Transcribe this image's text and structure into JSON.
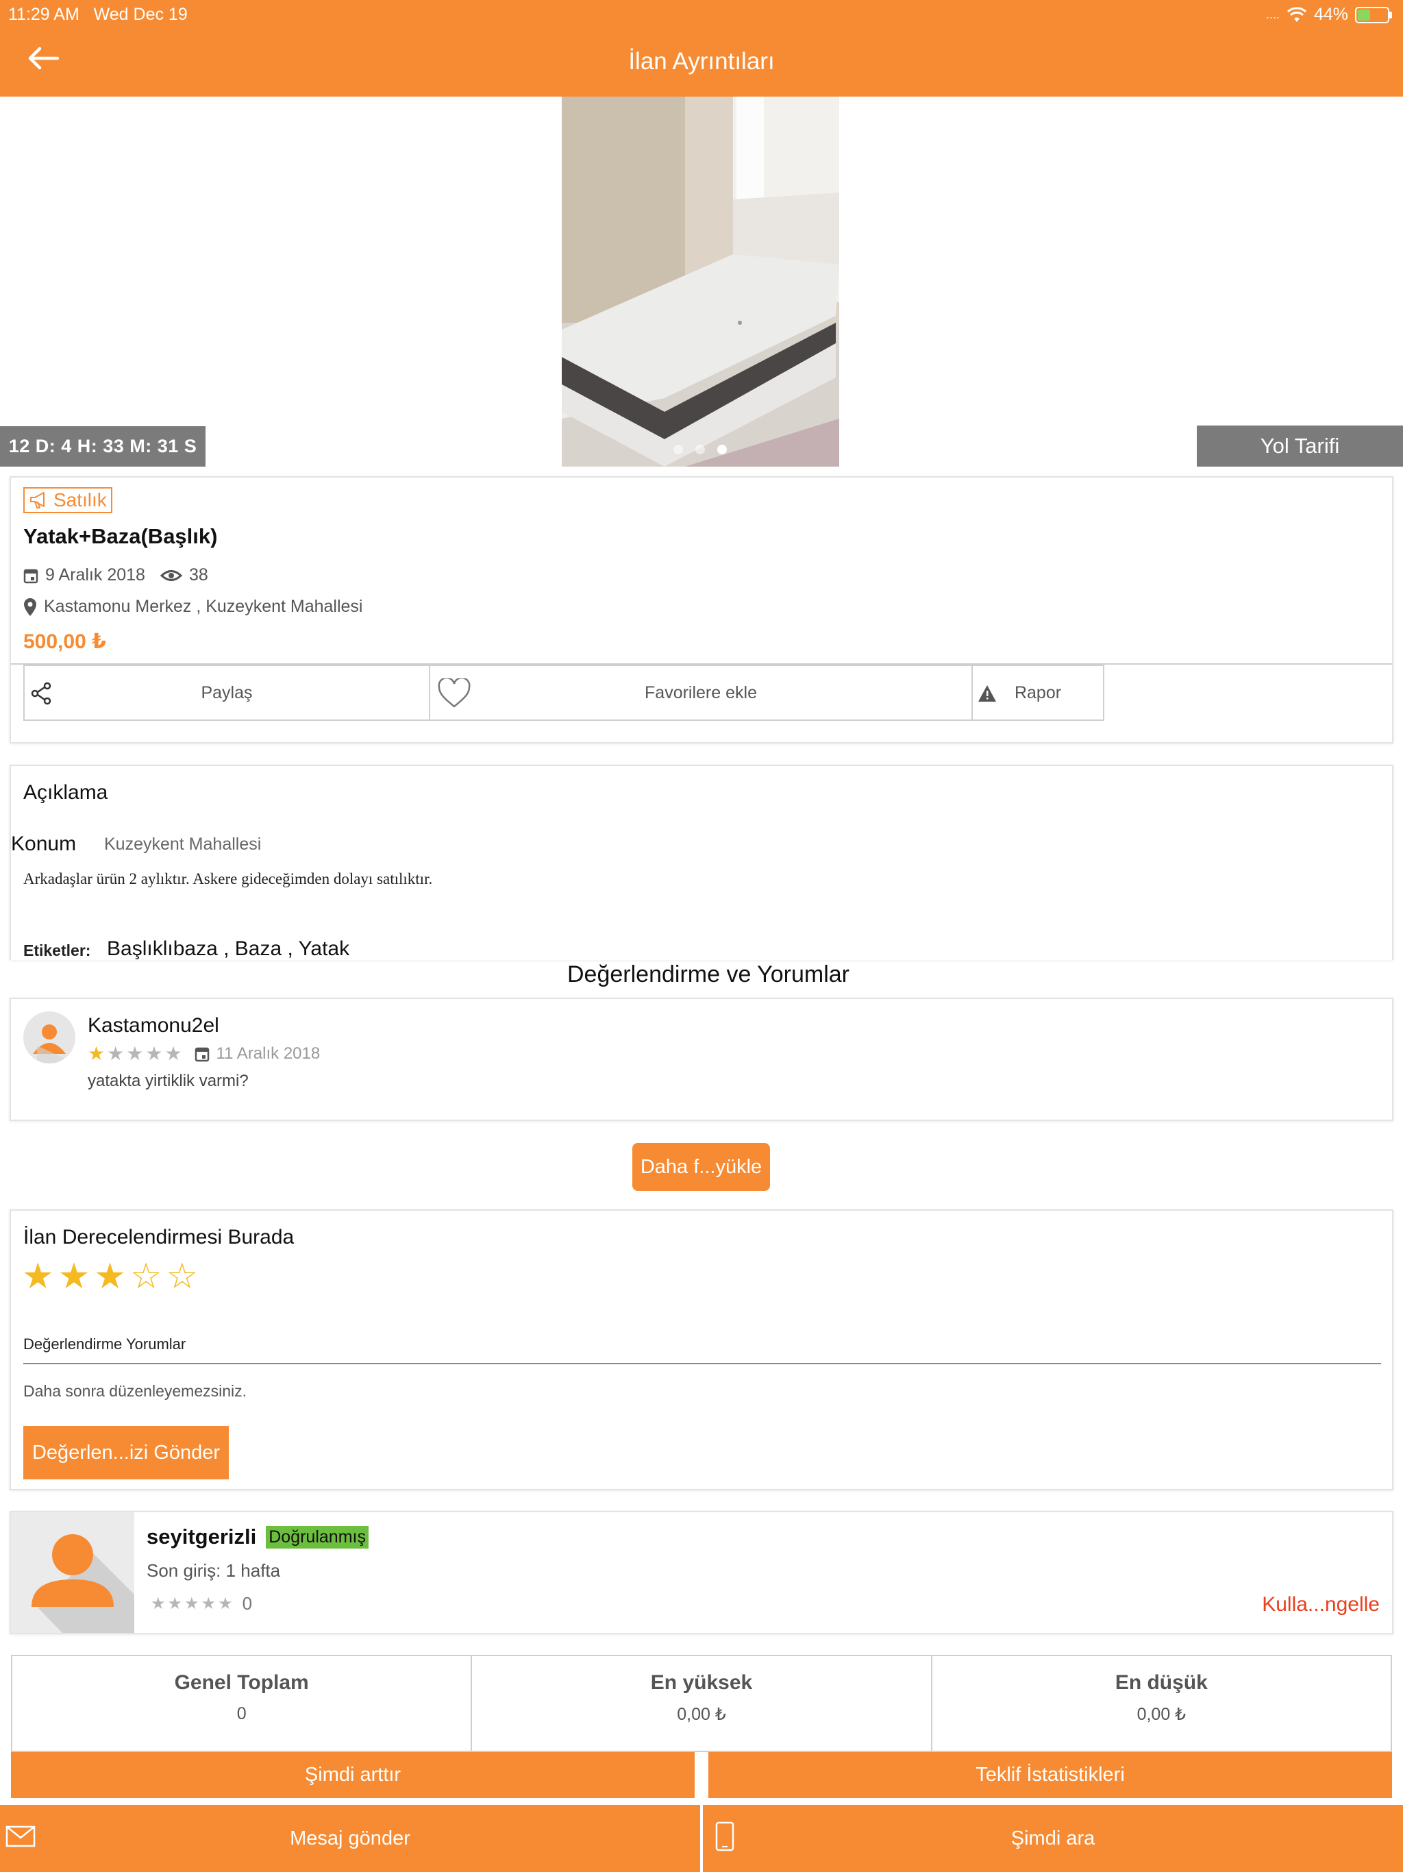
{
  "status_bar": {
    "time": "11:29 AM",
    "date": "Wed Dec 19",
    "signal": "....",
    "battery": "44%",
    "battery_level": 0.44
  },
  "header": {
    "title": "İlan Ayrıntıları"
  },
  "gallery": {
    "countdown": "12 D: 4 H: 33 M: 31 S",
    "route_button": "Yol Tarifi",
    "photo_count": 3,
    "active_photo": 3
  },
  "listing": {
    "tag": "Satılık",
    "title": "Yatak+Baza(Başlık)",
    "date": "9 Aralık 2018",
    "views": "38",
    "location": "Kastamonu Merkez , Kuzeykent Mahallesi",
    "price": "500,00 ₺",
    "actions": {
      "share": "Paylaş",
      "favorite": "Favorilere ekle",
      "report": "Rapor"
    }
  },
  "description": {
    "title": "Açıklama",
    "konum_label": "Konum",
    "konum_value": "Kuzeykent Mahallesi",
    "text": "Arkadaşlar ürün 2 aylıktır. Askere gideceğimden dolayı satılıktır.",
    "tags_label": "Etiketler:",
    "tags": "Başlıklıbaza , Baza , Yatak"
  },
  "reviews": {
    "title": "Değerlendirme ve Yorumlar",
    "items": [
      {
        "user": "Kastamonu2el",
        "rating": 1,
        "max_rating": 5,
        "date": "11 Aralık 2018",
        "text": "yatakta yirtiklik varmi?"
      }
    ],
    "load_more": "Daha f...yükle"
  },
  "rating_form": {
    "title": "İlan Derecelendirmesi Burada",
    "rating": 3,
    "max_rating": 5,
    "field_label": "Değerlendirme Yorumlar",
    "note": "Daha sonra düzenleyemezsiniz.",
    "submit": "Değerlen...izi Gönder"
  },
  "seller": {
    "name": "seyitgerizli",
    "badge": "Doğrulanmış",
    "last_login": "Son giriş: 1 hafta",
    "rating_count": "0",
    "block_link": "Kulla...ngelle"
  },
  "bids": {
    "total_label": "Genel Toplam",
    "total_value": "0",
    "highest_label": "En yüksek",
    "highest_value": "0,00 ₺",
    "lowest_label": "En düşük",
    "lowest_value": "0,00 ₺",
    "bid_now": "Şimdi arttır",
    "offer_stats": "Teklif İstatistikleri"
  },
  "bottom": {
    "message": "Mesaj gönder",
    "call": "Şimdi ara"
  },
  "colors": {
    "accent": "#f68b33",
    "verified": "#6cbf3e",
    "star": "#f5b921",
    "danger": "#e8401c"
  }
}
